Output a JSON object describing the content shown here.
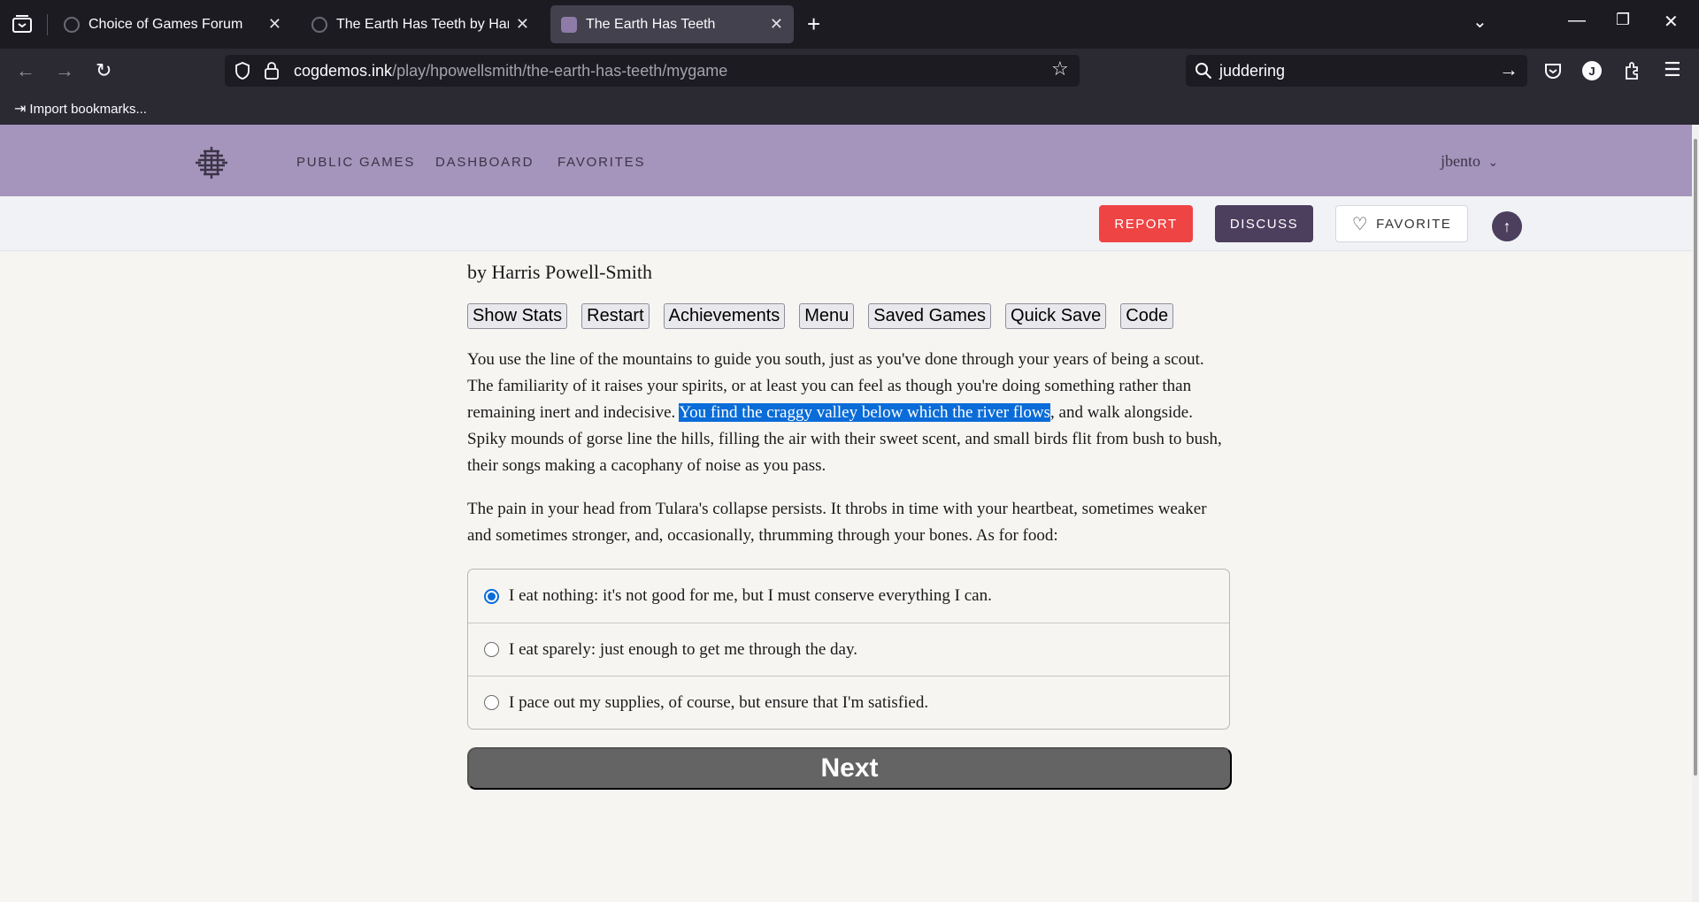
{
  "browser": {
    "tabs": [
      {
        "title": "Choice of Games Forum",
        "active": false
      },
      {
        "title": "The Earth Has Teeth by Harris Powell-Smith",
        "active": false
      },
      {
        "title": "The Earth Has Teeth",
        "active": true
      }
    ],
    "url_host": "cogdemos.ink",
    "url_path": "/play/hpowellsmith/the-earth-has-teeth/mygame",
    "search_query": "juddering",
    "bookmark_label": "Import bookmarks...",
    "profile_initial": "J"
  },
  "site": {
    "nav": [
      "PUBLIC GAMES",
      "DASHBOARD",
      "FAVORITES"
    ],
    "username": "jbento",
    "actions": {
      "report": "REPORT",
      "discuss": "DISCUSS",
      "favorite": "FAVORITE"
    }
  },
  "game": {
    "byline": "by Harris Powell-Smith",
    "buttons": [
      "Show Stats",
      "Restart",
      "Achievements",
      "Menu",
      "Saved Games",
      "Quick Save",
      "Code"
    ],
    "para1_before": "You use the line of the mountains to guide you south, just as you've done through your years of being a scout. The familiarity of it raises your spirits, or at least you can feel as though you're doing something rather than remaining inert and indecisive. ",
    "para1_highlight": "You find the craggy valley below which the river flows",
    "para1_after": ", and walk alongside. Spiky mounds of gorse line the hills, filling the air with their sweet scent, and small birds flit from bush to bush, their songs making a cacophany of noise as you pass.",
    "para2": "The pain in your head from Tulara's collapse persists. It throbs in time with your heartbeat, sometimes weaker and sometimes stronger, and, occasionally, thrumming through your bones. As for food:",
    "choices": [
      {
        "label": "I eat nothing: it's not good for me, but I must conserve everything I can.",
        "selected": true
      },
      {
        "label": "I eat sparely: just enough to get me through the day.",
        "selected": false
      },
      {
        "label": "I pace out my supplies, of course, but ensure that I'm satisfied.",
        "selected": false
      }
    ],
    "next_label": "Next"
  }
}
